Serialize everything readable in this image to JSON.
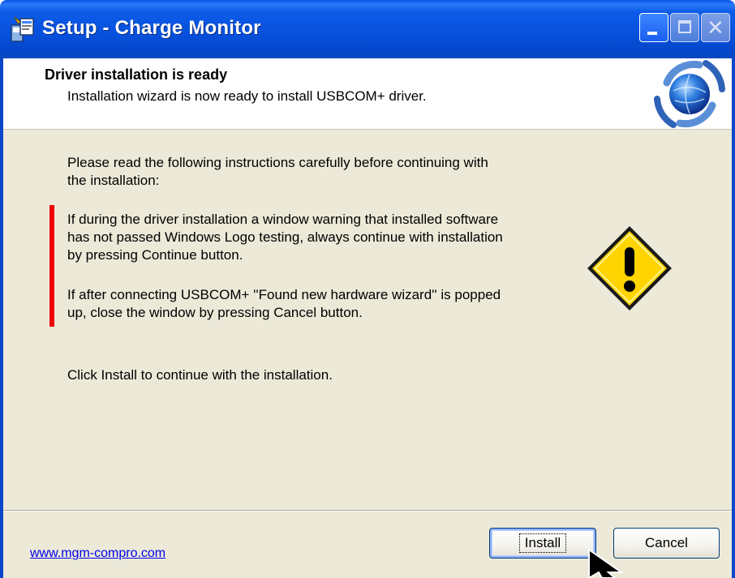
{
  "window": {
    "title": "Setup - Charge Monitor",
    "icons": {
      "app": "setup-installer-icon",
      "minimize": "minimize-icon",
      "maximize": "maximize-icon",
      "close": "close-icon"
    }
  },
  "header": {
    "title": "Driver installation is ready",
    "subtitle": "Installation wizard is now ready to install USBCOM+ driver.",
    "icon": "setup-globe-icon"
  },
  "content": {
    "intro": "Please read the following instructions carefully before continuing with\nthe installation:",
    "warning_1": "If during the driver installation a window warning that installed software\nhas not passed Windows Logo testing, always continue with installation\nby pressing Continue button.",
    "warning_2": "If after connecting USBCOM+ ''Found new hardware wizard'' is popped\nup, close the window by pressing Cancel button.",
    "click_install": "Click Install to continue with the installation.",
    "warning_icon": "warning-icon"
  },
  "footer": {
    "link": "www.mgm-compro.com",
    "install_label": "Install",
    "cancel_label": "Cancel"
  },
  "colors": {
    "titlebar": "#0650dc",
    "body": "#ece9d8",
    "warning_bar": "#ee0000",
    "link": "#0000ee"
  }
}
